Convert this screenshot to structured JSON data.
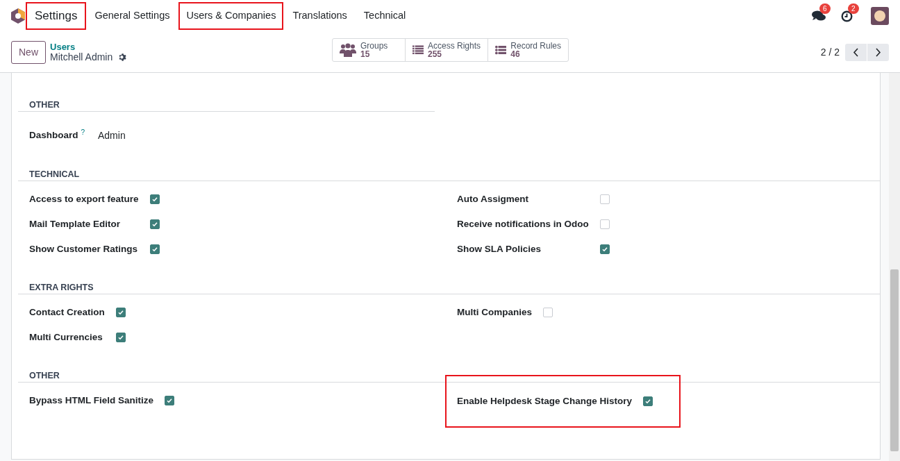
{
  "navbar": {
    "app": {
      "label": "Settings",
      "highlighted": true
    },
    "menus": [
      {
        "label": "General Settings",
        "highlighted": false
      },
      {
        "label": "Users & Companies",
        "highlighted": true
      },
      {
        "label": "Translations",
        "highlighted": false
      },
      {
        "label": "Technical",
        "highlighted": false
      }
    ],
    "messages_badge": "6",
    "activities_badge": "2"
  },
  "control_panel": {
    "new_button": "New",
    "breadcrumb": "Users",
    "record_title": "Mitchell Admin",
    "smart_buttons": [
      {
        "kind": "groups",
        "label": "Groups",
        "count": "15"
      },
      {
        "kind": "list",
        "label": "Access Rights",
        "count": "255"
      },
      {
        "kind": "bullets",
        "label": "Record Rules",
        "count": "46"
      }
    ],
    "pager": "2 / 2"
  },
  "sections": [
    {
      "title": "OTHER",
      "kind": "fields",
      "fields": [
        {
          "label": "Dashboard",
          "help": "?",
          "value": "Admin"
        }
      ]
    },
    {
      "title": "TECHNICAL",
      "kind": "checks",
      "left": [
        {
          "label": "Access to export feature",
          "checked": true,
          "highlighted": false
        },
        {
          "label": "Mail Template Editor",
          "checked": true,
          "highlighted": false
        },
        {
          "label": "Show Customer Ratings",
          "checked": true,
          "highlighted": false
        }
      ],
      "right": [
        {
          "label": "Auto Assigment",
          "checked": false,
          "highlighted": false
        },
        {
          "label": "Receive notifications in Odoo",
          "checked": false,
          "highlighted": false
        },
        {
          "label": "Show SLA Policies",
          "checked": true,
          "highlighted": false
        }
      ]
    },
    {
      "title": "EXTRA RIGHTS",
      "kind": "checks",
      "left": [
        {
          "label": "Contact Creation",
          "checked": true,
          "highlighted": false
        },
        {
          "label": "Multi Currencies",
          "checked": true,
          "highlighted": false
        }
      ],
      "right": [
        {
          "label": "Multi Companies",
          "checked": false,
          "highlighted": false
        }
      ]
    },
    {
      "title": "OTHER",
      "kind": "checks",
      "left": [
        {
          "label": "Bypass HTML Field Sanitize",
          "checked": true,
          "highlighted": false
        }
      ],
      "right": [
        {
          "label": "Enable Helpdesk Stage Change History",
          "checked": true,
          "highlighted": true
        }
      ]
    }
  ]
}
